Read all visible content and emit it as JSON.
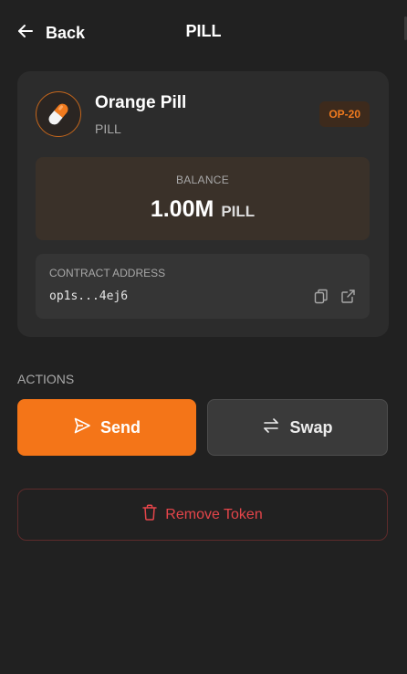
{
  "header": {
    "back_label": "Back",
    "title": "PILL"
  },
  "token": {
    "name": "Orange Pill",
    "symbol": "PILL",
    "standard_badge": "OP-20",
    "icon": "orange-pill-icon"
  },
  "balance": {
    "label": "BALANCE",
    "amount": "1.00M",
    "unit": "PILL"
  },
  "contract": {
    "label": "CONTRACT ADDRESS",
    "address": "op1s...4ej6",
    "copy_icon": "copy-icon",
    "open_icon": "external-link-icon"
  },
  "actions": {
    "section_label": "ACTIONS",
    "send_label": "Send",
    "send_icon": "send-icon",
    "swap_label": "Swap",
    "swap_icon": "swap-arrows-icon",
    "remove_label": "Remove Token",
    "remove_icon": "trash-icon"
  },
  "colors": {
    "background": "#212121",
    "card": "#2c2c2c",
    "accent": "#f47518",
    "danger": "#e5454a"
  }
}
